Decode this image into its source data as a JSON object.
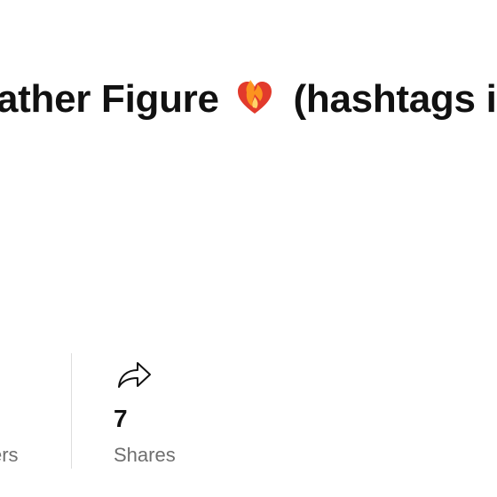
{
  "post": {
    "title_before": "ather Figure",
    "title_after": "(hashtags i"
  },
  "stats": {
    "left_label_fragment": "ers",
    "shares_count": "7",
    "shares_label": "Shares"
  },
  "icons": {
    "heart": "heart-on-fire-icon",
    "share": "share-arrow-icon"
  },
  "colors": {
    "text": "#111111",
    "muted": "#6f6f6f",
    "divider": "#dddddd",
    "heart": "#e23a2c",
    "flame": "#ff9d1e"
  }
}
